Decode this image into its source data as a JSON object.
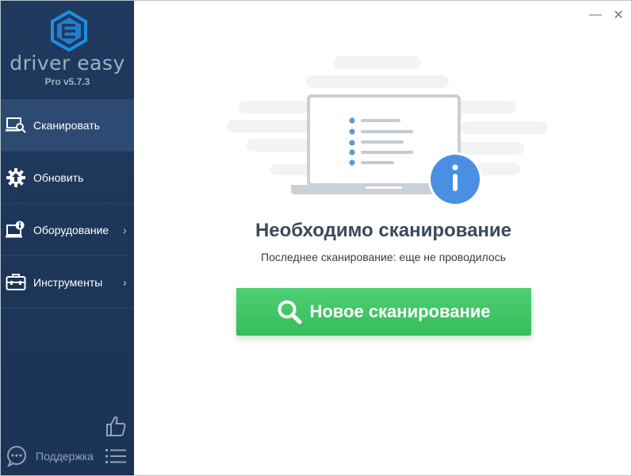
{
  "app": {
    "name": "driver easy",
    "version": "Pro v5.7.3"
  },
  "sidebar": {
    "items": [
      {
        "label": "Сканировать",
        "icon": "scan-laptop-icon",
        "active": true,
        "has_submenu": false
      },
      {
        "label": "Обновить",
        "icon": "gear-upload-icon",
        "active": false,
        "has_submenu": false
      },
      {
        "label": "Оборудование",
        "icon": "hardware-info-icon",
        "active": false,
        "has_submenu": true
      },
      {
        "label": "Инструменты",
        "icon": "toolbox-icon",
        "active": false,
        "has_submenu": true
      }
    ],
    "chevron": "›",
    "support_label": "Поддержка"
  },
  "window": {
    "minimize_glyph": "—",
    "close_glyph": "✕"
  },
  "main": {
    "heading": "Необходимо сканирование",
    "subtext": "Последнее сканирование: еще не проводилось",
    "scan_button_label": "Новое сканирование"
  },
  "colors": {
    "sidebar_bg": "#1f3a5e",
    "sidebar_active": "#2c4a72",
    "accent_green": "#3cc463",
    "info_blue": "#4a90e2",
    "heading_text": "#3b4a5c"
  }
}
